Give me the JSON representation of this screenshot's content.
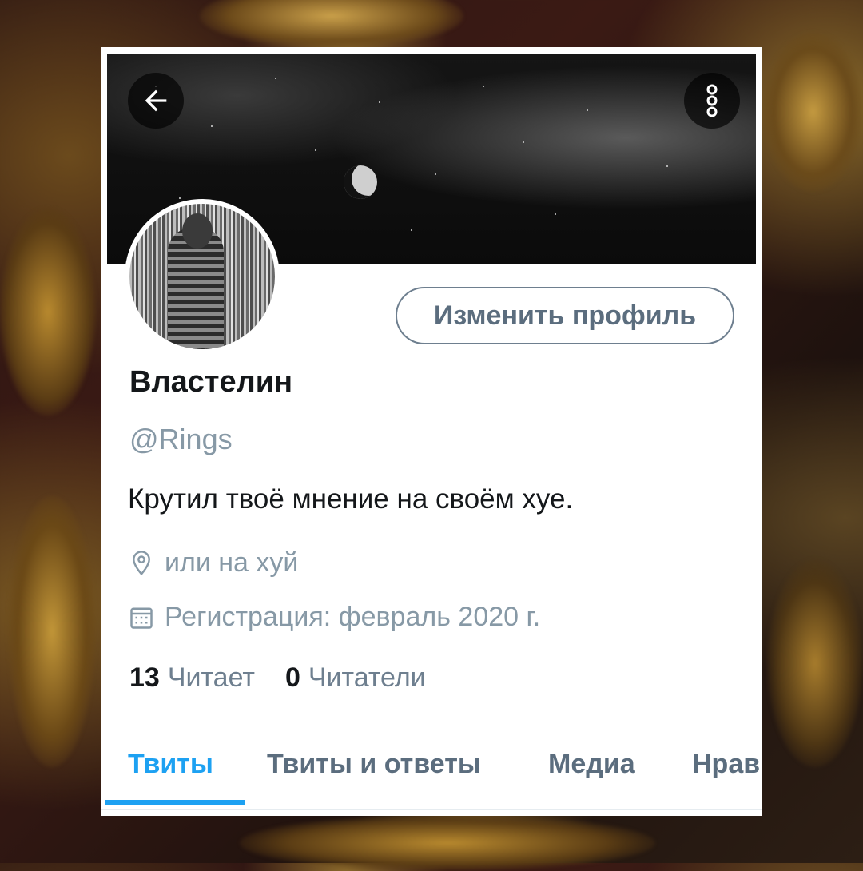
{
  "header": {
    "back_icon": "arrow-left-icon",
    "more_icon": "more-vertical-icon"
  },
  "profile": {
    "edit_button_label": "Изменить профиль",
    "display_name": "Властелин",
    "handle": "@Rings",
    "bio": "Крутил твоё мнение на своём хуе.",
    "location": "или на хуй",
    "location_icon": "location-pin-icon",
    "joined": "Регистрация: февраль 2020 г.",
    "joined_icon": "calendar-icon",
    "following_count": "13",
    "following_label": "Читает",
    "followers_count": "0",
    "followers_label": "Читатели"
  },
  "tabs": [
    {
      "label": "Твиты",
      "active": true
    },
    {
      "label": "Твиты и ответы",
      "active": false
    },
    {
      "label": "Медиа",
      "active": false
    },
    {
      "label": "Нрав",
      "active": false
    }
  ],
  "colors": {
    "accent": "#1da1f2",
    "secondary_text": "#8799a6",
    "primary_text": "#14171a"
  }
}
